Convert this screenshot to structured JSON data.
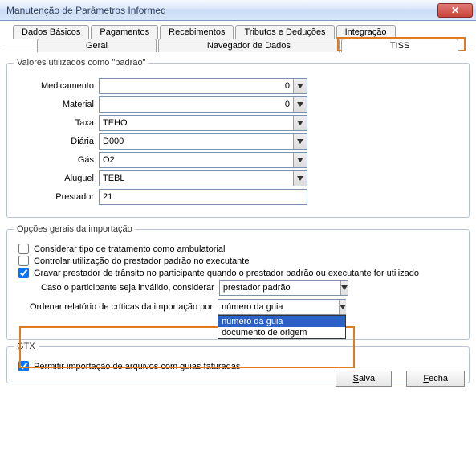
{
  "window": {
    "title": "Manutenção de Parâmetros Informed"
  },
  "tabs1": {
    "t0": "Dados Básicos",
    "t1": "Pagamentos",
    "t2": "Recebimentos",
    "t3": "Tributos e Deduções",
    "t4": "Integração"
  },
  "tabs2": {
    "t0": "Geral",
    "t1": "Navegador de Dados",
    "t2": "TISS"
  },
  "group1": {
    "legend": "Valores utilizados como \"padrão\"",
    "medicamento_lbl": "Medicamento",
    "medicamento_val": "0",
    "material_lbl": "Material",
    "material_val": "0",
    "taxa_lbl": "Taxa",
    "taxa_val": "TEHO",
    "diaria_lbl": "Diária",
    "diaria_val": "D000",
    "gas_lbl": "Gás",
    "gas_val": "O2",
    "aluguel_lbl": "Aluguel",
    "aluguel_val": "TEBL",
    "prestador_lbl": "Prestador",
    "prestador_val": "21"
  },
  "group2": {
    "legend": "Opções gerais da importação",
    "chk1": "Considerar tipo de tratamento como ambulatorial",
    "chk2": "Controlar utilização do prestador padrão no executante",
    "chk3": "Gravar prestador de trânsito no participante quando o prestador padrão ou executante for utilizado",
    "invalid_lbl": "Caso o participante seja inválido, considerar",
    "invalid_val": "prestador padrão",
    "order_lbl": "Ordenar relatório de críticas da importação por",
    "order_val": "número da guia",
    "order_opt1": "número da guia",
    "order_opt2": "documento de origem"
  },
  "group3": {
    "legend": "GTX",
    "chk1": "Permitir importação de arquivos com guias faturadas"
  },
  "buttons": {
    "save_u": "S",
    "save_rest": "alva",
    "close_u": "F",
    "close_rest": "echa"
  }
}
